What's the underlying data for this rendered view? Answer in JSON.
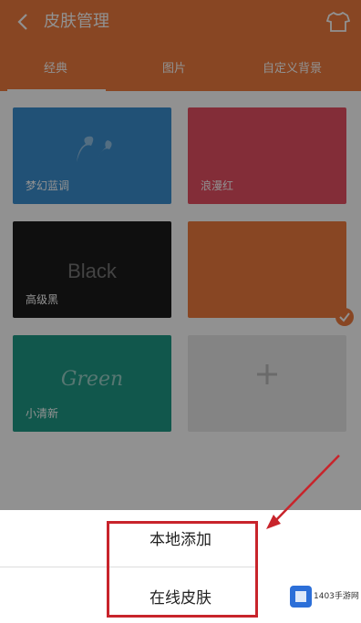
{
  "header": {
    "title": "皮肤管理",
    "tabs": [
      "经典",
      "图片",
      "自定义背景"
    ]
  },
  "themes": [
    {
      "label": "梦幻蓝调",
      "script": "",
      "color": "#3a8fd0"
    },
    {
      "label": "浪漫红",
      "script": "",
      "color": "#e64f63"
    },
    {
      "label": "高级黑",
      "word": "Black",
      "color": "#1c1c1c"
    },
    {
      "label": "",
      "script": "",
      "color": "#f07c3f"
    },
    {
      "label": "小清新",
      "script": "Green",
      "color": "#1e9a86"
    }
  ],
  "sheet": {
    "item_local": "本地添加",
    "item_online": "在线皮肤"
  },
  "watermark": {
    "text": "1403手游网"
  },
  "colors": {
    "accent": "#f07c3f",
    "annotation": "#c8242b"
  }
}
